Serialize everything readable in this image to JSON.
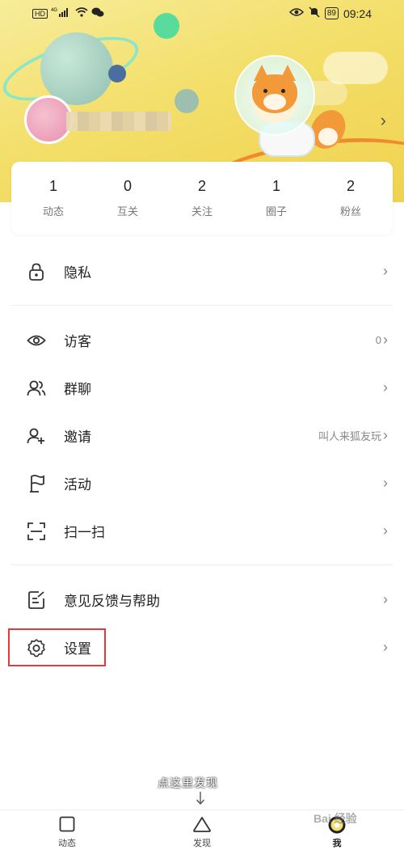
{
  "status_bar": {
    "left": "HD 4G",
    "battery": "89",
    "time": "09:24"
  },
  "stats": [
    {
      "value": "1",
      "label": "动态"
    },
    {
      "value": "0",
      "label": "互关"
    },
    {
      "value": "2",
      "label": "关注"
    },
    {
      "value": "1",
      "label": "圈子"
    },
    {
      "value": "2",
      "label": "粉丝"
    }
  ],
  "menu": {
    "privacy": {
      "label": "隐私"
    },
    "visitors": {
      "label": "访客",
      "value": "0"
    },
    "group_chat": {
      "label": "群聊"
    },
    "invite": {
      "label": "邀请",
      "value": "叫人来狐友玩"
    },
    "activity": {
      "label": "活动"
    },
    "scan": {
      "label": "扫一扫"
    },
    "feedback": {
      "label": "意见反馈与帮助"
    },
    "settings": {
      "label": "设置"
    }
  },
  "hint_text": "点这里发现",
  "tabbar": [
    {
      "label": "动态",
      "icon": "square-icon"
    },
    {
      "label": "发现",
      "icon": "triangle-icon"
    },
    {
      "label": "我",
      "icon": "me-avatar-icon"
    }
  ],
  "watermark": "Bai 经验",
  "colors": {
    "header_yellow": "#f3df6a",
    "highlight_red": "#e03a3a",
    "fox_orange": "#f29a3a"
  }
}
